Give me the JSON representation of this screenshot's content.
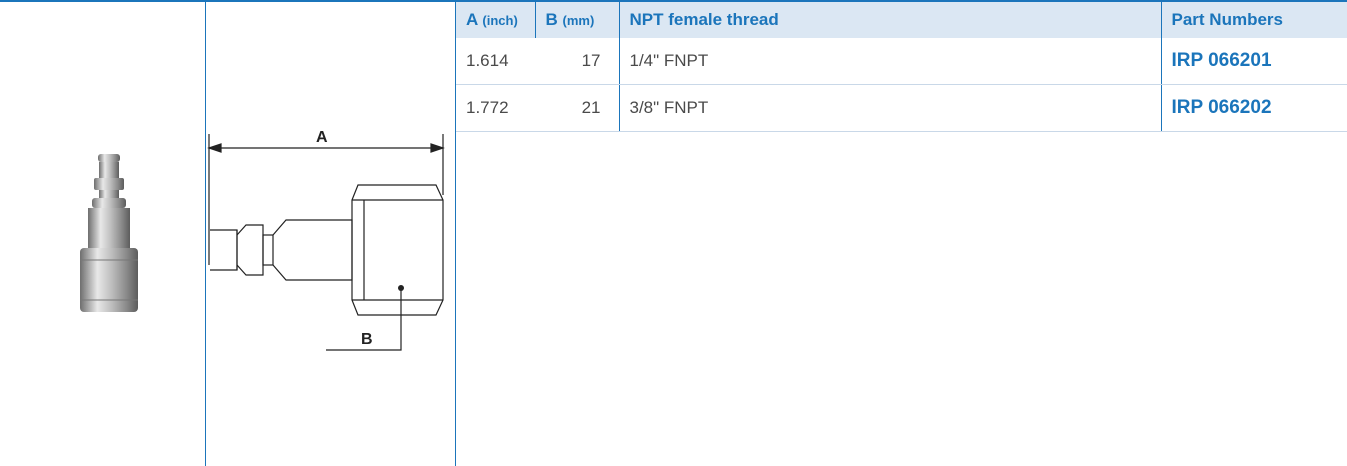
{
  "table": {
    "headers": {
      "a": {
        "label": "A",
        "unit": "(inch)"
      },
      "b": {
        "label": "B",
        "unit": "(mm)"
      },
      "thread": {
        "label": "NPT female thread"
      },
      "part": {
        "label": "Part Numbers"
      }
    },
    "rows": [
      {
        "a": "1.614",
        "b": "17",
        "thread": "1/4\" FNPT",
        "part": "IRP 066201"
      },
      {
        "a": "1.772",
        "b": "21",
        "thread": "3/8\" FNPT",
        "part": "IRP 066202"
      }
    ]
  },
  "drawing": {
    "label_a": "A",
    "label_b": "B"
  },
  "colors": {
    "accent": "#1b75bb",
    "header_bg": "#dbe7f3"
  }
}
